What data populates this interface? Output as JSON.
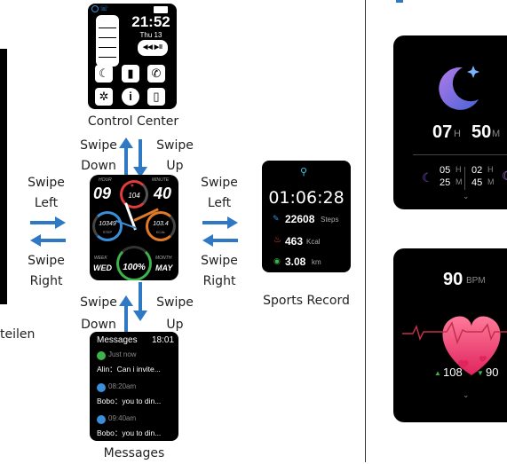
{
  "left_edge_text": "teilen",
  "control_center": {
    "caption": "Control Center",
    "time": "21:52",
    "date": "Thu 13",
    "media_glyphs": "◀◀ ▶II ▶▶",
    "moon_icon": "moon-icon",
    "flashlight_icon": "flashlight-icon",
    "phone_icon": "phone-icon",
    "settings_icon": "gear-icon",
    "info_icon": "info-icon",
    "watch_icon": "watch-icon"
  },
  "gestures": {
    "swipe_down_top": [
      "Swipe",
      "Down"
    ],
    "swipe_up_top": [
      "Swipe",
      "Up"
    ],
    "swipe_left_left": [
      "Swipe",
      "Left"
    ],
    "swipe_right_left": [
      "Swipe",
      "Right"
    ],
    "swipe_left_right": [
      "Swipe",
      "Left"
    ],
    "swipe_right_right": [
      "Swipe",
      "Right"
    ],
    "swipe_down_bottom": [
      "Swipe",
      "Down"
    ],
    "swipe_up_bottom": [
      "Swipe",
      "Up"
    ]
  },
  "watch_face": {
    "hour_label": "HOUR",
    "minute_label": "MINUTE",
    "hour": "09",
    "minute": "40",
    "heart_rate": "104",
    "steps": "10349",
    "steps_unit": "STEP",
    "kcal": "103.4",
    "kcal_unit": "KCAL",
    "week_label": "WEEK",
    "month_label": "MONTH",
    "weekday": "WED",
    "battery": "100%",
    "month": "MAY",
    "colors": {
      "steps_ring": "#3a8fd8",
      "kcal_ring": "#e07a28",
      "battery_ring": "#3cb44b",
      "hr_ring": "#e23b3b"
    }
  },
  "sports_record": {
    "caption": "Sports Record",
    "duration": "01:06:28",
    "steps": "22608",
    "steps_unit": "Steps",
    "kcal": "463",
    "kcal_unit": "Kcal",
    "distance": "3.08",
    "distance_unit": "km"
  },
  "messages": {
    "caption": "Messages",
    "header": "Messages",
    "time": "18:01",
    "items": [
      {
        "time": "Just now",
        "text": "Alin：Can i invite...",
        "color": "#3cb44b"
      },
      {
        "time": "08:20am",
        "text": "Bobo：you to din...",
        "color": "#3a8fd8"
      },
      {
        "time": "09:40am",
        "text": "Bobo：you to din...",
        "color": "#3a8fd8"
      }
    ]
  },
  "sleep_screen": {
    "hours": "07",
    "hours_unit": "H",
    "minutes": "50",
    "minutes_unit": "M",
    "deep_h": "05",
    "deep_h_unit": "H",
    "deep_m": "25",
    "deep_m_unit": "M",
    "light_h": "02",
    "light_h_unit": "H",
    "light_m": "45",
    "light_m_unit": "M"
  },
  "heart_screen": {
    "bpm": "90",
    "bpm_unit": "BPM",
    "max": "108",
    "min": "90"
  }
}
